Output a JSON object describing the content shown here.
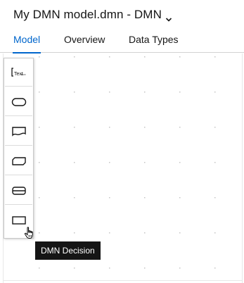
{
  "header": {
    "title": "My DMN model.dmn - DMN",
    "caret_icon": "chevron-down-icon"
  },
  "tabs": [
    {
      "label": "Model",
      "active": true
    },
    {
      "label": "Overview",
      "active": false
    },
    {
      "label": "Data Types",
      "active": false
    }
  ],
  "palette": {
    "items": [
      {
        "name": "text-annotation",
        "icon": "text-annotation-icon"
      },
      {
        "name": "input-data",
        "icon": "input-data-icon"
      },
      {
        "name": "knowledge-source",
        "icon": "knowledge-source-icon"
      },
      {
        "name": "business-knowledge-model",
        "icon": "bkm-icon"
      },
      {
        "name": "decision-service",
        "icon": "decision-service-icon"
      },
      {
        "name": "decision",
        "icon": "decision-icon"
      }
    ]
  },
  "tooltip": {
    "text": "DMN Decision"
  },
  "colors": {
    "accent": "#0066cc",
    "text": "#151515",
    "tooltip_bg": "#151515",
    "grid_dot": "#c4c4c4",
    "border": "#d2d2d2"
  }
}
